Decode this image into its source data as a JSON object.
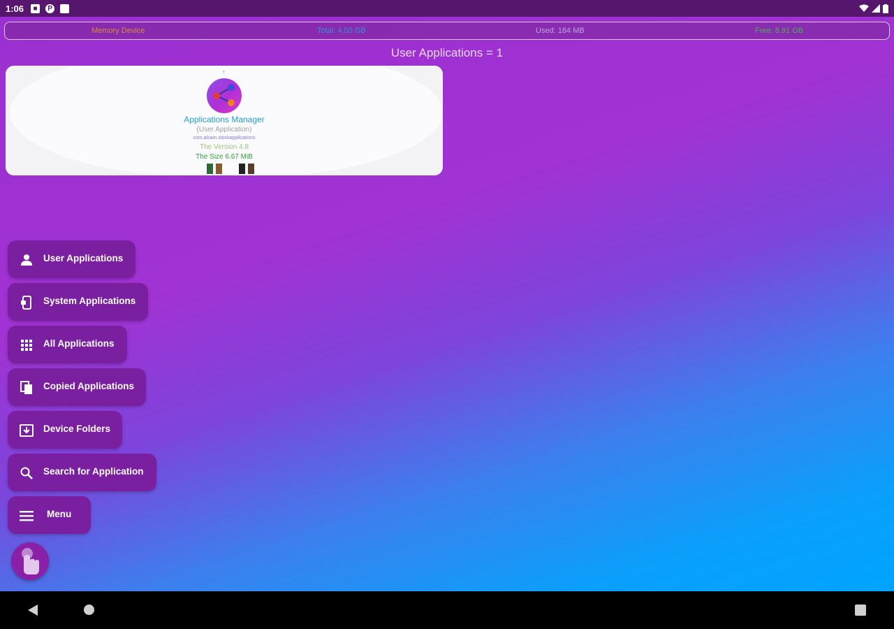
{
  "status_bar": {
    "time": "1:06",
    "icons": [
      "notification-icon",
      "p-icon",
      "sd-card-icon"
    ],
    "right_icons": [
      "wifi-icon",
      "signal-icon",
      "battery-icon"
    ]
  },
  "memory_bar": {
    "device": "Memory Device",
    "total": "Total: 4.00 GB",
    "used": "Used: 184 MB",
    "free": "Free: 8.91 GB"
  },
  "page_title": "User Applications = 1",
  "app_card": {
    "name": "Applications Manager",
    "type": "(User Application)",
    "package": "com.alsam.stockapplications",
    "version": "The Version 4.8",
    "size": "The Size 6.67 MiB",
    "pointer": "↑"
  },
  "menu": {
    "items": [
      {
        "label": "User Applications",
        "icon": "person-icon"
      },
      {
        "label": "System Applications",
        "icon": "system-apps-icon"
      },
      {
        "label": "All Applications",
        "icon": "grid-icon"
      },
      {
        "label": "Copied Applications",
        "icon": "copy-icon"
      },
      {
        "label": "Device Folders",
        "icon": "folder-download-icon"
      },
      {
        "label": "Search for Application",
        "icon": "search-icon"
      },
      {
        "label": "Menu",
        "icon": "hamburger-icon"
      }
    ],
    "fab_icon": "touch-hand-icon"
  },
  "colors": {
    "menu_button": "#7a1fa0",
    "gradient_top": "#9c2fd1",
    "gradient_bottom": "#00a4ff"
  }
}
